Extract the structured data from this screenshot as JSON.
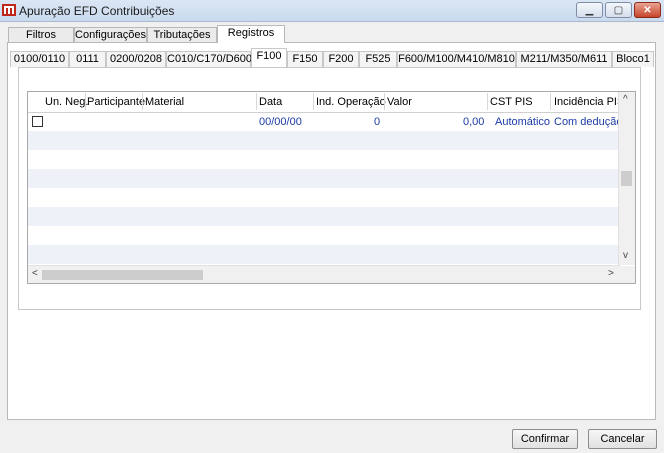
{
  "window": {
    "title": "Apuração EFD Contribuições",
    "minimize_glyph": "▁",
    "maximize_glyph": "▢",
    "close_glyph": "✕"
  },
  "top_tabs": [
    "Filtros",
    "Configurações",
    "Tributações",
    "Registros"
  ],
  "register_tabs": [
    "0100/0110",
    "0111",
    "0200/0208",
    "C010/C170/D600",
    "F100",
    "F150",
    "F200",
    "F525",
    "F600/M100/M410/M810",
    "M211/M350/M611",
    "Bloco1"
  ],
  "grid": {
    "columns": [
      "Un. Neg.",
      "Participante",
      "Material",
      "Data",
      "Ind. Operação",
      "Valor",
      "CST PIS",
      "Incidência PIS"
    ],
    "rows": [
      {
        "data": "00/00/00",
        "ind_operacao": "0",
        "valor": "0,00",
        "cst_pis": "Automático",
        "incidencia_pis": "Com dedução"
      }
    ]
  },
  "scroll": {
    "up": "^",
    "down": "v",
    "left": "<",
    "right": ">"
  },
  "buttons": {
    "confirm": "Confirmar",
    "cancel": "Cancelar"
  }
}
